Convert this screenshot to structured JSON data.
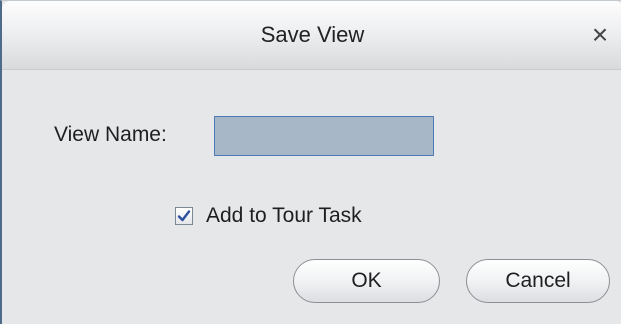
{
  "dialog": {
    "title": "Save View",
    "close_glyph": "×"
  },
  "form": {
    "view_name_label": "View Name:",
    "view_name_value": "",
    "add_to_tour_label": "Add to Tour Task",
    "add_to_tour_checked": true
  },
  "buttons": {
    "ok_label": "OK",
    "cancel_label": "Cancel"
  },
  "icons": {
    "close": "close-icon",
    "checkmark": "checkmark-icon"
  },
  "colors": {
    "input_background": "#a8b7c8",
    "input_border": "#4a7db6",
    "check_mark": "#2c4f9e"
  }
}
